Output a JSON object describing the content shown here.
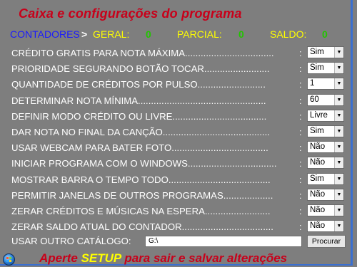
{
  "title": "Caixa e configurações do programa",
  "counters": {
    "label": "CONTADORES",
    "arrow": ">",
    "geral_label": "GERAL:",
    "geral_value": "0",
    "parcial_label": "PARCIAL:",
    "parcial_value": "0",
    "saldo_label": "SALDO:",
    "saldo_value": "0"
  },
  "colon": ":",
  "settings": [
    {
      "label": "CRÉDITO GRATIS PARA NOTA MÁXIMA..................................",
      "value": "Sim"
    },
    {
      "label": "PRIORIDADE SEGURANDO BOTÃO TOCAR.........................",
      "value": "Sim"
    },
    {
      "label": "QUANTIDADE DE CRÉDITOS POR PULSO..........................",
      "value": "1"
    },
    {
      "label": "DETERMINAR NOTA MÍNIMA.................................................",
      "value": "60"
    },
    {
      "label": "DEFINIR MODO CRÉDITO OU LIVRE....................................",
      "value": "Livre"
    },
    {
      "label": "DAR NOTA NO FINAL DA CANÇÃO.........................................",
      "value": "Sim"
    },
    {
      "label": "USAR WEBCAM PARA BATER FOTO.....................................",
      "value": "Não"
    },
    {
      "label": "INICIAR PROGRAMA COM O WINDOWS..................................",
      "value": "Não"
    },
    {
      "label": "MOSTRAR BARRA O TEMPO TODO.......................................",
      "value": "Sim"
    },
    {
      "label": "PERMITIR JANELAS DE OUTROS PROGRAMAS...................",
      "value": "Não"
    },
    {
      "label": "ZERAR CRÉDITOS E MÚSICAS NA ESPERA.........................",
      "value": "Não"
    },
    {
      "label": "ZERAR SALDO ATUAL DO CONTADOR...................................",
      "value": "Não"
    }
  ],
  "catalog": {
    "label": "USAR OUTRO CATÁLOGO:",
    "path": "G:\\",
    "browse_label": "Procurar"
  },
  "footer": {
    "before": "Aperte ",
    "highlight": "SETUP",
    "after": " para sair e salvar alterações"
  },
  "colors": {
    "background": "#7e7e7e",
    "title": "#c8001a",
    "counter_label": "#1a1aff",
    "counter_key": "#ffff00",
    "counter_value": "#22c400"
  },
  "icons": {
    "start": "windows-start-orb-icon",
    "dropdown": "chevron-down-icon"
  }
}
